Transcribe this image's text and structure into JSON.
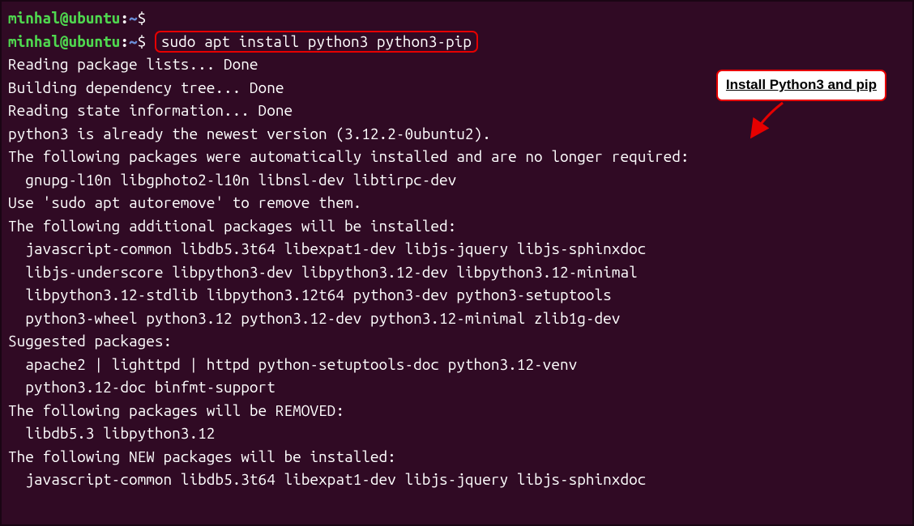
{
  "prompt": {
    "user": "minhal@ubuntu",
    "path": "~",
    "symbol": "$"
  },
  "command": "sudo apt install python3 python3-pip",
  "callout": "Install Python3 and pip",
  "output": [
    "Reading package lists... Done",
    "Building dependency tree... Done",
    "Reading state information... Done",
    "python3 is already the newest version (3.12.2-0ubuntu2).",
    "The following packages were automatically installed and are no longer required:",
    "  gnupg-l10n libgphoto2-l10n libnsl-dev libtirpc-dev",
    "Use 'sudo apt autoremove' to remove them.",
    "The following additional packages will be installed:",
    "  javascript-common libdb5.3t64 libexpat1-dev libjs-jquery libjs-sphinxdoc",
    "  libjs-underscore libpython3-dev libpython3.12-dev libpython3.12-minimal",
    "  libpython3.12-stdlib libpython3.12t64 python3-dev python3-setuptools",
    "  python3-wheel python3.12 python3.12-dev python3.12-minimal zlib1g-dev",
    "Suggested packages:",
    "  apache2 | lighttpd | httpd python-setuptools-doc python3.12-venv",
    "  python3.12-doc binfmt-support",
    "The following packages will be REMOVED:",
    "  libdb5.3 libpython3.12",
    "The following NEW packages will be installed:",
    "  javascript-common libdb5.3t64 libexpat1-dev libjs-jquery libjs-sphinxdoc"
  ]
}
